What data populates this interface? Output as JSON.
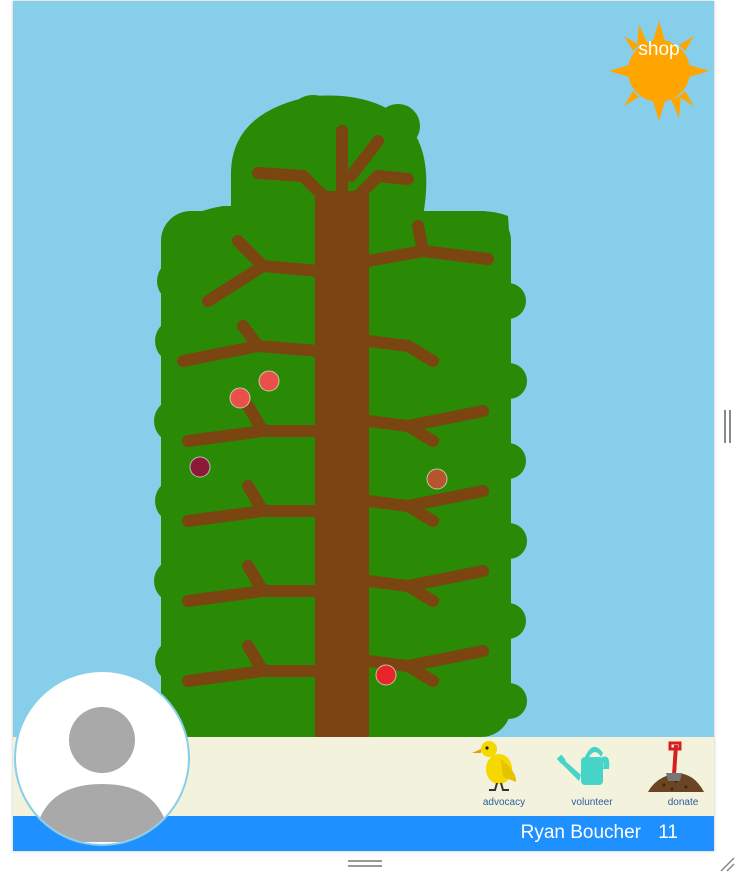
{
  "header": {
    "shop_label": "shop"
  },
  "tree": {
    "fruits": [
      {
        "color": "#e8504a"
      },
      {
        "color": "#e8504a"
      },
      {
        "color": "#8b1a3a"
      },
      {
        "color": "#b5552e"
      },
      {
        "color": "#e8262a"
      }
    ]
  },
  "actions": [
    {
      "label": "advocacy",
      "icon": "canary-icon"
    },
    {
      "label": "volunteer",
      "icon": "watering-can-icon"
    },
    {
      "label": "donate",
      "icon": "shovel-dirt-icon"
    }
  ],
  "user": {
    "name": "Ryan Boucher",
    "score": "11"
  },
  "colors": {
    "sky": "#87ceeb",
    "foliage": "#2a8a06",
    "trunk": "#7a4511",
    "sun": "#ffa500",
    "ground": "#f3f2dc",
    "bar": "#1e90ff"
  }
}
